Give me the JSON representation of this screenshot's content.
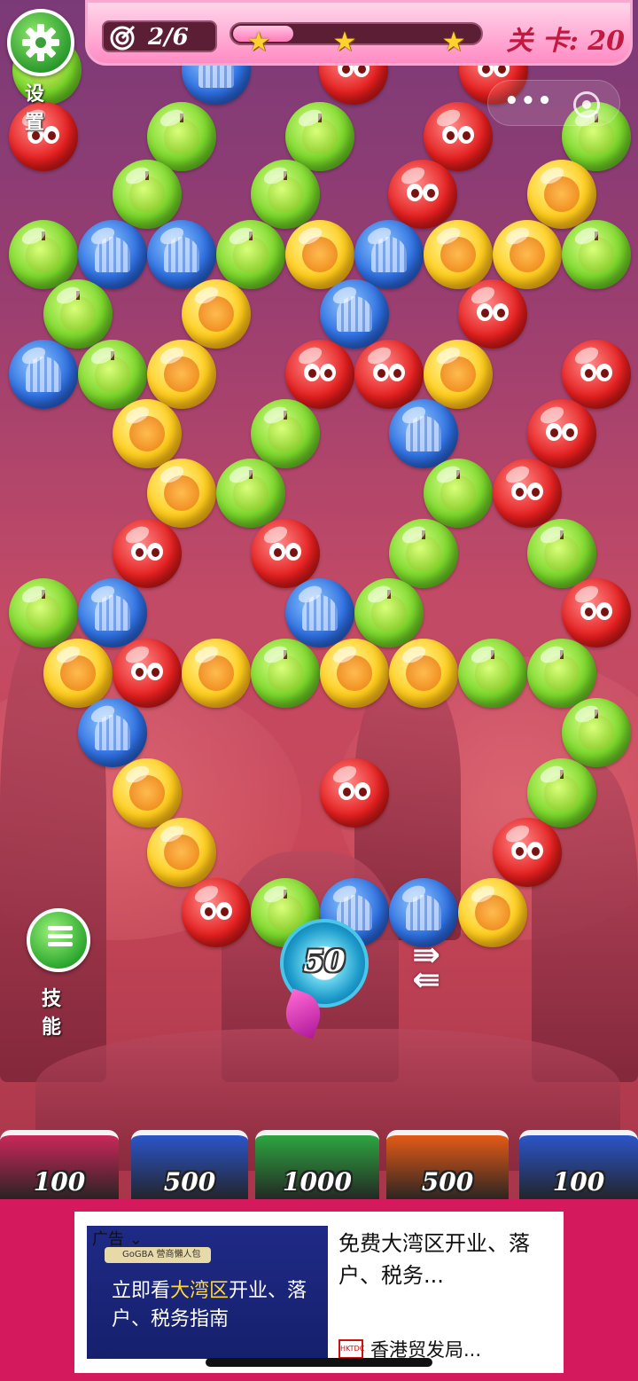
{
  "hud": {
    "settings_label": "设 置",
    "target_progress": "2/6",
    "progress_fraction": 0.24,
    "stars": [
      "star-1",
      "star-2",
      "star-3"
    ],
    "level_text": "关 卡: 20"
  },
  "miniprogram_capsule": {
    "menu_dots": "•••",
    "close_icon": "target-circle-icon"
  },
  "shooter": {
    "shots_left": "50"
  },
  "skills": {
    "label": "技 能"
  },
  "buckets": [
    {
      "value": "100",
      "color": "#c9285a"
    },
    {
      "value": "500",
      "color": "#2b55c8"
    },
    {
      "value": "1000",
      "color": "#2da540"
    },
    {
      "value": "500",
      "color": "#e35a16"
    },
    {
      "value": "100",
      "color": "#2b55c8"
    }
  ],
  "ad": {
    "tag": "广告",
    "badge": "GoGBA 營商懶人包",
    "headline_pre": "立即看",
    "headline_hl": "大湾区",
    "headline_post": "开业、落户、税务指南",
    "description": "免费大湾区开业、落户、税务...",
    "source_logo": "HKTDC",
    "source": "香港贸发局..."
  },
  "bubbles": [
    {
      "c": "green"
    },
    {
      "c": "blue"
    },
    {
      "c": "red"
    },
    {
      "c": "red"
    },
    {
      "c": "red"
    },
    {
      "c": "green"
    },
    {
      "c": "green"
    },
    {
      "c": "red"
    },
    {
      "c": "green"
    },
    {
      "c": "green"
    },
    {
      "c": "green"
    },
    {
      "c": "red"
    },
    {
      "c": "yellow"
    },
    {
      "c": "green"
    },
    {
      "c": "blue"
    },
    {
      "c": "blue"
    },
    {
      "c": "green"
    },
    {
      "c": "yellow"
    },
    {
      "c": "blue"
    },
    {
      "c": "yellow"
    },
    {
      "c": "yellow"
    },
    {
      "c": "green"
    },
    {
      "c": "green"
    },
    {
      "c": "yellow"
    },
    {
      "c": "blue"
    },
    {
      "c": "red"
    },
    {
      "c": "blue"
    },
    {
      "c": "green"
    },
    {
      "c": "yellow"
    },
    {
      "c": "red"
    },
    {
      "c": "red"
    },
    {
      "c": "yellow"
    },
    {
      "c": "red"
    },
    {
      "c": "yellow"
    },
    {
      "c": "green"
    },
    {
      "c": "blue"
    },
    {
      "c": "red"
    },
    {
      "c": "yellow"
    },
    {
      "c": "green"
    },
    {
      "c": "green"
    },
    {
      "c": "red"
    },
    {
      "c": "red"
    },
    {
      "c": "red"
    },
    {
      "c": "green"
    },
    {
      "c": "green"
    },
    {
      "c": "green"
    },
    {
      "c": "blue"
    },
    {
      "c": "blue"
    },
    {
      "c": "green"
    },
    {
      "c": "red"
    },
    {
      "c": "yellow"
    },
    {
      "c": "red"
    },
    {
      "c": "yellow"
    },
    {
      "c": "green"
    },
    {
      "c": "yellow"
    },
    {
      "c": "yellow"
    },
    {
      "c": "green"
    },
    {
      "c": "green"
    },
    {
      "c": "blue"
    },
    {
      "c": "green"
    },
    {
      "c": "yellow"
    },
    {
      "c": "red"
    },
    {
      "c": "green"
    },
    {
      "c": "yellow"
    },
    {
      "c": "red"
    },
    {
      "c": "red"
    },
    {
      "c": "green"
    },
    {
      "c": "blue"
    },
    {
      "c": "blue"
    },
    {
      "c": "yellow"
    }
  ]
}
